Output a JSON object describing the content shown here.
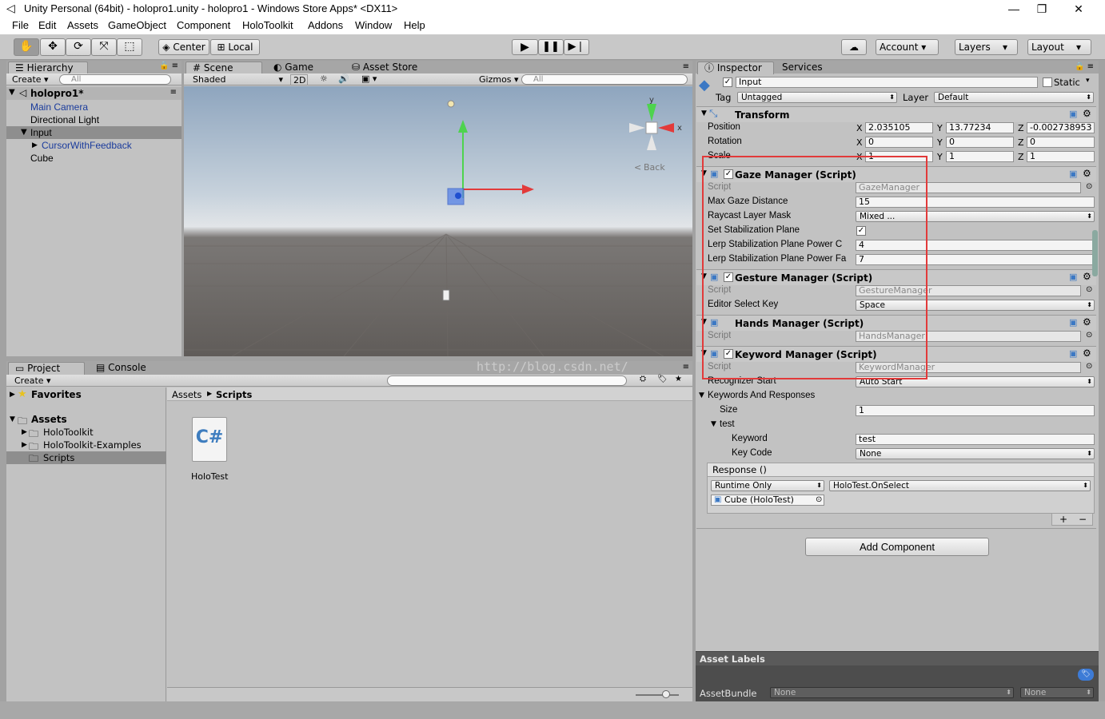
{
  "window": {
    "title": "Unity Personal (64bit) - holopro1.unity - holopro1 - Windows Store Apps* <DX11>"
  },
  "menu": [
    "File",
    "Edit",
    "Assets",
    "GameObject",
    "Component",
    "HoloToolkit",
    "Addons",
    "Window",
    "Help"
  ],
  "toolbar": {
    "center": "Center",
    "local": "Local",
    "account": "Account",
    "layers": "Layers",
    "layout": "Layout"
  },
  "hierarchy": {
    "tab": "Hierarchy",
    "create": "Create",
    "search": "All",
    "scene": "holopro1*",
    "items": [
      "Main Camera",
      "Directional Light",
      "Input",
      "CursorWithFeedback",
      "Cube"
    ]
  },
  "scene_tabs": {
    "scene": "Scene",
    "game": "Game",
    "store": "Asset Store",
    "shaded": "Shaded",
    "mode2d": "2D",
    "gizmos": "Gizmos",
    "search": "All",
    "back": "Back",
    "axis_y": "y",
    "axis_x": "x"
  },
  "project": {
    "tab": "Project",
    "console": "Console",
    "create": "Create",
    "favorites": "Favorites",
    "assets": "Assets",
    "folders": [
      "HoloToolkit",
      "HoloToolkit-Examples",
      "Scripts"
    ],
    "breadcrumb_root": "Assets",
    "breadcrumb_current": "Scripts",
    "file_name": "HoloTest",
    "file_glyph": "C#"
  },
  "inspector": {
    "tab": "Inspector",
    "services": "Services",
    "object_name": "Input",
    "static": "Static",
    "tag_label": "Tag",
    "tag": "Untagged",
    "layer_label": "Layer",
    "layer": "Default",
    "transform": {
      "title": "Transform",
      "position_label": "Position",
      "rotation_label": "Rotation",
      "scale_label": "Scale",
      "position": [
        "2.035105",
        "13.77234",
        "-0.002738953"
      ],
      "rotation": [
        "0",
        "0",
        "0"
      ],
      "scale": [
        "1",
        "1",
        "1"
      ],
      "axes": [
        "X",
        "Y",
        "Z"
      ]
    },
    "gaze": {
      "title": "Gaze Manager (Script)",
      "script_label": "Script",
      "script": "GazeManager",
      "max_label": "Max Gaze Distance",
      "max": "15",
      "mask_label": "Raycast Layer Mask",
      "mask": "Mixed ...",
      "stab_label": "Set Stabilization Plane",
      "lerp1_label": "Lerp Stabilization Plane Power C",
      "lerp1": "4",
      "lerp2_label": "Lerp Stabilization Plane Power Fa",
      "lerp2": "7"
    },
    "gesture": {
      "title": "Gesture Manager (Script)",
      "script_label": "Script",
      "script": "GestureManager",
      "key_label": "Editor Select Key",
      "key": "Space"
    },
    "hands": {
      "title": "Hands Manager (Script)",
      "script_label": "Script",
      "script": "HandsManager"
    },
    "keyword": {
      "title": "Keyword Manager (Script)",
      "script_label": "Script",
      "script": "KeywordManager",
      "rec_label": "Recognizer Start",
      "rec": "Auto Start",
      "kr_label": "Keywords And Responses",
      "size_label": "Size",
      "size": "1",
      "elem": "test",
      "kw_label": "Keyword",
      "kw": "test",
      "kc_label": "Key Code",
      "kc": "None",
      "response": "Response ()",
      "runtime": "Runtime Only",
      "func": "HoloTest.OnSelect",
      "obj": "Cube (HoloTest)",
      "plus": "+",
      "minus": "−"
    },
    "add_component": "Add Component",
    "asset_labels": "Asset Labels",
    "assetbundle": "AssetBundle",
    "none1": "None",
    "none2": "None"
  },
  "watermark": "http://blog.csdn.net/",
  "colors": {
    "highlight": "#e23a3a",
    "selected": "#8e8e8e",
    "link": "#1a3b9c"
  }
}
